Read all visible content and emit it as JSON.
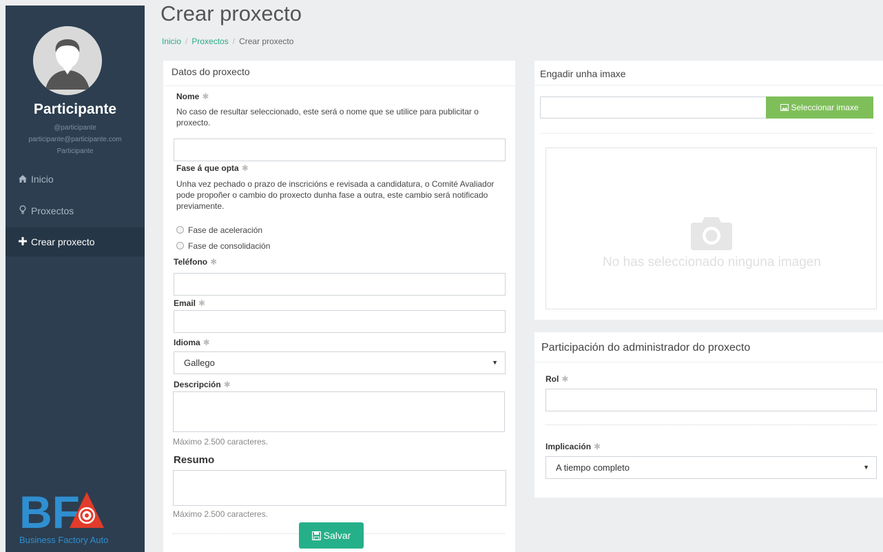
{
  "sidebar": {
    "user": {
      "name": "Participante",
      "handle": "@participante",
      "email": "participante@participante.com",
      "role": "Participante"
    },
    "nav": [
      {
        "label": "Inicio",
        "icon": "home-icon"
      },
      {
        "label": "Proxectos",
        "icon": "lightbulb-icon"
      },
      {
        "label": "Crear proxecto",
        "icon": "plus-icon"
      }
    ],
    "logo": {
      "letters": "BFA",
      "tagline": "Business Factory Auto"
    }
  },
  "header": {
    "title": "Crear proxecto",
    "breadcrumb": [
      "Inicio",
      "Proxectos",
      "Crear proxecto"
    ],
    "breadcrumb_sep": "/"
  },
  "form": {
    "panel_title": "Datos do proxecto",
    "nome": {
      "label": "Nome",
      "help": "No caso de resultar seleccionado, este será o nome que se utilice para publicitar o proxecto.",
      "value": ""
    },
    "fase": {
      "label": "Fase á que opta",
      "help": "Unha vez pechado o prazo de inscricións e revisada a candidatura, o Comité Avaliador pode propoñer o cambio do proxecto dunha fase a outra, este cambio será notificado previamente.",
      "options": [
        "Fase de aceleración",
        "Fase de consolidación"
      ]
    },
    "telefono": {
      "label": "Teléfono",
      "value": ""
    },
    "email": {
      "label": "Email",
      "value": ""
    },
    "idioma": {
      "label": "Idioma",
      "selected": "Gallego"
    },
    "descripcion": {
      "label": "Descripción",
      "hint": "Máximo 2.500 caracteres."
    },
    "resumo": {
      "label": "Resumo",
      "hint": "Máximo 2.500 caracteres."
    },
    "save_label": "Salvar"
  },
  "image_panel": {
    "title": "Engadir unha imaxe",
    "button_label": "Seleccionar imaxe",
    "placeholder_text": "No has seleccionado ninguna imagen"
  },
  "admin_panel": {
    "title": "Participación do administrador do proxecto",
    "rol": {
      "label": "Rol",
      "value": ""
    },
    "implicacion": {
      "label": "Implicación",
      "selected": "A tiempo completo"
    }
  },
  "colors": {
    "sidebar_bg": "#2c3e50",
    "accent_green": "#26b08a",
    "image_button": "#7fbf5a",
    "logo_blue": "#2f8fd0",
    "logo_red": "#e23b2b"
  }
}
